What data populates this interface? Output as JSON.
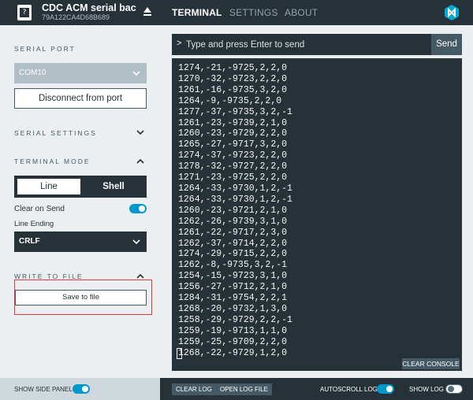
{
  "header": {
    "device_name": "CDC ACM serial backe…",
    "device_serial": "79A122CA4D68B689",
    "device_icon": "?",
    "icons": [
      "device-icon",
      "eject-icon",
      "nordic-logo-icon"
    ],
    "tabs": [
      {
        "label": "TERMINAL",
        "active": true
      },
      {
        "label": "SETTINGS",
        "active": false
      },
      {
        "label": "ABOUT",
        "active": false
      }
    ]
  },
  "sidebar": {
    "serial_port": {
      "title": "SERIAL PORT",
      "selected_port": "COM10",
      "disconnect_label": "Disconnect from port"
    },
    "serial_settings": {
      "title": "SERIAL SETTINGS",
      "expanded": false
    },
    "terminal_mode": {
      "title": "TERMINAL MODE",
      "expanded": true,
      "options": [
        "Line",
        "Shell"
      ],
      "selected": "Line",
      "clear_on_send_label": "Clear on Send",
      "clear_on_send": true,
      "line_ending_label": "Line Ending",
      "line_ending_value": "CRLF"
    },
    "write_to_file": {
      "title": "WRITE TO FILE",
      "expanded": true,
      "save_label": "Save to file"
    }
  },
  "terminal": {
    "prompt": ">",
    "input_placeholder": "Type and press Enter to send",
    "input_value": "",
    "send_label": "Send",
    "clear_console_label": "CLEAR CONSOLE",
    "lines": [
      "1274,-21,-9725,2,2,0",
      "1270,-32,-9723,2,2,0",
      "1261,-16,-9735,3,2,0",
      "1264,-9,-9735,2,2,0",
      "1277,-37,-9735,3,2,-1",
      "1261,-23,-9739,2,1,0",
      "1260,-23,-9729,2,2,0",
      "1265,-27,-9717,3,2,0",
      "1274,-37,-9723,2,2,0",
      "1278,-32,-9727,2,2,0",
      "1271,-23,-9725,2,2,0",
      "1264,-33,-9730,1,2,-1",
      "1264,-33,-9730,1,2,-1",
      "1260,-23,-9721,2,1,0",
      "1262,-26,-9739,3,1,0",
      "1261,-22,-9717,2,3,0",
      "1262,-37,-9714,2,2,0",
      "1274,-29,-9715,2,2,0",
      "1262,-8,-9735,3,2,-1",
      "1254,-15,-9723,3,1,0",
      "1256,-27,-9712,2,1,0",
      "1284,-31,-9754,2,2,1",
      "1268,-20,-9732,1,3,0",
      "1258,-29,-9729,2,2,-1",
      "1259,-19,-9713,1,1,0",
      "1259,-25,-9709,2,2,0",
      "1268,-22,-9729,1,2,0"
    ]
  },
  "footer": {
    "show_side_panel_label": "SHOW SIDE PANEL",
    "show_side_panel": true,
    "clear_log_label": "CLEAR LOG",
    "open_log_file_label": "OPEN LOG FILE",
    "autoscroll_log_label": "AUTOSCROLL LOG",
    "autoscroll_log": true,
    "show_log_label": "SHOW LOG",
    "show_log": false
  },
  "colors": {
    "header_bg": "#263238",
    "panel_bg": "#eceff1",
    "accent": "#0097cd",
    "highlight": "#e53935"
  }
}
